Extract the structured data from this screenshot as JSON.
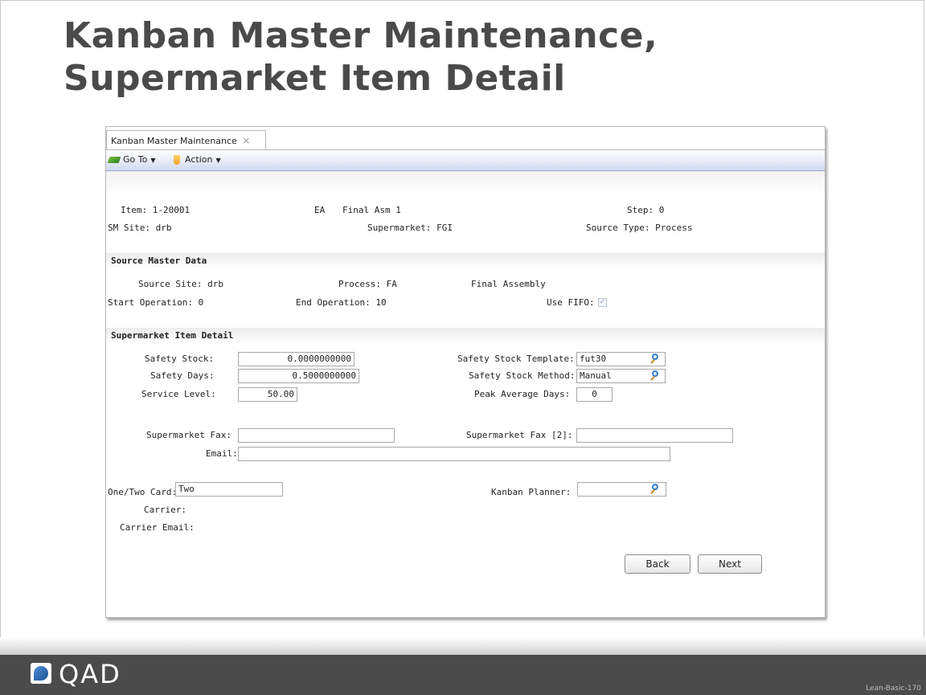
{
  "slide": {
    "title": "Kanban Master Maintenance, Supermarket Item Detail",
    "footer_logo_text": "QAD",
    "slide_id": "Lean-Basic-170"
  },
  "app": {
    "tab_label": "Kanban Master Maintenance",
    "tab_close": "×",
    "toolbar": {
      "goto_label": "Go To",
      "action_label": "Action",
      "caret": "▼"
    },
    "header": {
      "item": "Item: 1-20001",
      "um": "EA",
      "desc": "Final Asm 1",
      "step": "Step: 0",
      "sm_site": "SM Site: drb",
      "supermarket": "Supermarket: FGI",
      "source_type": "Source Type: Process"
    },
    "source_master": {
      "section_title": "Source Master Data",
      "source_site": "Source Site: drb",
      "process": "Process: FA",
      "process_desc": "Final Assembly",
      "start_op": "Start Operation: 0",
      "end_op": "End Operation: 10",
      "use_fifo_label": "Use FIFO:",
      "use_fifo_checked": "✓"
    },
    "supermarket_detail": {
      "section_title": "Supermarket Item Detail",
      "safety_stock_label": "Safety Stock:",
      "safety_stock_value": "0.0000000000",
      "safety_days_label": "Safety Days:",
      "safety_days_value": "0.5000000000",
      "service_level_label": "Service Level:",
      "service_level_value": "50.00",
      "ss_template_label": "Safety Stock Template:",
      "ss_template_value": "fut30",
      "ss_method_label": "Safety Stock Method:",
      "ss_method_value": "Manual",
      "peak_avg_label": "Peak Average Days:",
      "peak_avg_value": "0",
      "fax_label": "Supermarket Fax:",
      "fax_value": "",
      "fax2_label": "Supermarket Fax [2]:",
      "fax2_value": "",
      "email_label": "Email:",
      "email_value": "",
      "one_two_label": "One/Two Card:",
      "one_two_value": "Two",
      "planner_label": "Kanban Planner:",
      "planner_value": "",
      "carrier_label": "Carrier:",
      "carrier_email_label": "Carrier Email:"
    },
    "buttons": {
      "back": "Back",
      "next": "Next"
    }
  }
}
